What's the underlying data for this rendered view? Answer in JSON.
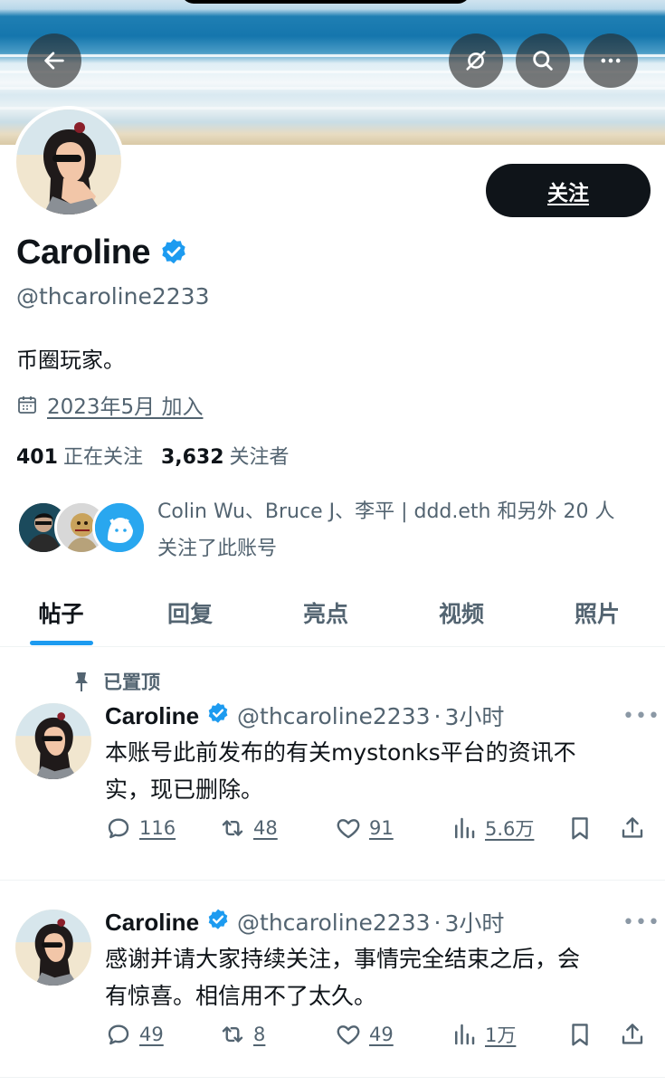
{
  "profile": {
    "name": "Caroline",
    "handle": "@thcaroline2233",
    "bio": "币圈玩家。",
    "joined": "2023年5月 加入",
    "following_count": "401",
    "following_label": "正在关注",
    "followers_count": "3,632",
    "followers_label": "关注者",
    "follow_button": "关注",
    "known_followers_line1": "Colin Wu、Bruce J、李平 | ddd.eth 和另外 20 人",
    "known_followers_line2": "关注了此账号"
  },
  "header_buttons": [
    "back-icon",
    "hide-icon",
    "search-icon",
    "more-icon"
  ],
  "tabs": [
    {
      "label": "帖子",
      "active": true
    },
    {
      "label": "回复",
      "active": false
    },
    {
      "label": "亮点",
      "active": false
    },
    {
      "label": "视频",
      "active": false
    },
    {
      "label": "照片",
      "active": false
    }
  ],
  "pinned_label": "已置顶",
  "posts": [
    {
      "name": "Caroline",
      "handle": "@thcaroline2233",
      "time": "3小时",
      "text_line1": "本账号此前发布的有关mystonks平台的资讯不",
      "text_line2": "实，现已删除。",
      "replies": "116",
      "reposts": "48",
      "likes": "91",
      "views": "5.6万"
    },
    {
      "name": "Caroline",
      "handle": "@thcaroline2233",
      "time": "3小时",
      "text_line1": "感谢并请大家持续关注，事情完全结束之后，会",
      "text_line2": "有惊喜。相信用不了太久。",
      "replies": "49",
      "reposts": "8",
      "likes": "49",
      "views": "1万"
    }
  ],
  "colors": {
    "accent": "#1d9bf0",
    "text": "#0f1419",
    "secondary": "#536471"
  }
}
